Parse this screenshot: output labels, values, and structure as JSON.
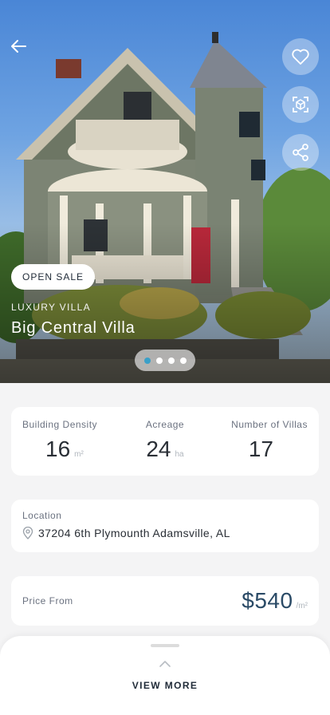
{
  "hero": {
    "badge": "OPEN SALE",
    "category": "LUXURY VILLA",
    "title": "Big Central Villa",
    "carousel": {
      "count": 4,
      "active_index": 0
    }
  },
  "actions": {
    "back_icon": "arrow-left-icon",
    "favorite_icon": "heart-icon",
    "ar_icon": "ar-view-icon",
    "share_icon": "share-icon"
  },
  "stats": [
    {
      "label": "Building Density",
      "value": "16",
      "unit": "m²"
    },
    {
      "label": "Acreage",
      "value": "24",
      "unit": "ha"
    },
    {
      "label": "Number of Villas",
      "value": "17",
      "unit": ""
    }
  ],
  "location": {
    "label": "Location",
    "icon": "map-pin-icon",
    "address": "37204 6th Plymounth Adamsville, AL"
  },
  "price": {
    "label": "Price From",
    "amount": "$540",
    "unit": "/m²"
  },
  "sheet": {
    "icon": "chevron-up-icon",
    "label": "VIEW MORE"
  },
  "colors": {
    "accent": "#3aa0c8",
    "price": "#2a4a66",
    "text": "#1f2a37",
    "background": "#f4f4f5"
  }
}
